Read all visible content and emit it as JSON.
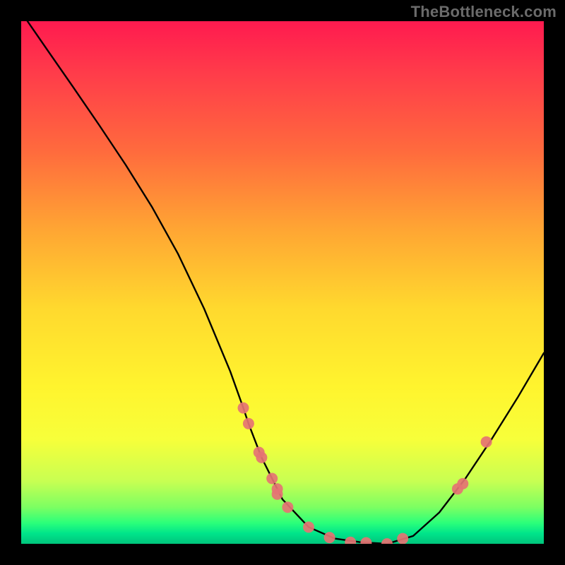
{
  "watermark": "TheBottleneck.com",
  "chart_data": {
    "type": "line",
    "title": "",
    "xlabel": "",
    "ylabel": "",
    "xlim": [
      0,
      1
    ],
    "ylim": [
      0,
      1
    ],
    "series": [
      {
        "name": "bottleneck-curve",
        "x": [
          0.012,
          0.05,
          0.1,
          0.15,
          0.2,
          0.25,
          0.3,
          0.35,
          0.4,
          0.425,
          0.435,
          0.46,
          0.5,
          0.55,
          0.6,
          0.65,
          0.7,
          0.75,
          0.8,
          0.85,
          0.9,
          0.95,
          1.0
        ],
        "y": [
          1.0,
          0.945,
          0.873,
          0.8,
          0.725,
          0.645,
          0.555,
          0.45,
          0.33,
          0.26,
          0.23,
          0.165,
          0.085,
          0.032,
          0.01,
          0.003,
          0.0,
          0.015,
          0.06,
          0.125,
          0.2,
          0.28,
          0.365
        ]
      }
    ],
    "markers": {
      "name": "data-points",
      "color": "#e57373",
      "x": [
        0.425,
        0.435,
        0.455,
        0.46,
        0.48,
        0.49,
        0.49,
        0.51,
        0.55,
        0.59,
        0.63,
        0.66,
        0.7,
        0.73,
        0.835,
        0.845,
        0.89
      ],
      "y": [
        0.26,
        0.23,
        0.175,
        0.165,
        0.125,
        0.105,
        0.095,
        0.07,
        0.032,
        0.012,
        0.003,
        0.002,
        0.0,
        0.01,
        0.105,
        0.115,
        0.195
      ]
    }
  }
}
